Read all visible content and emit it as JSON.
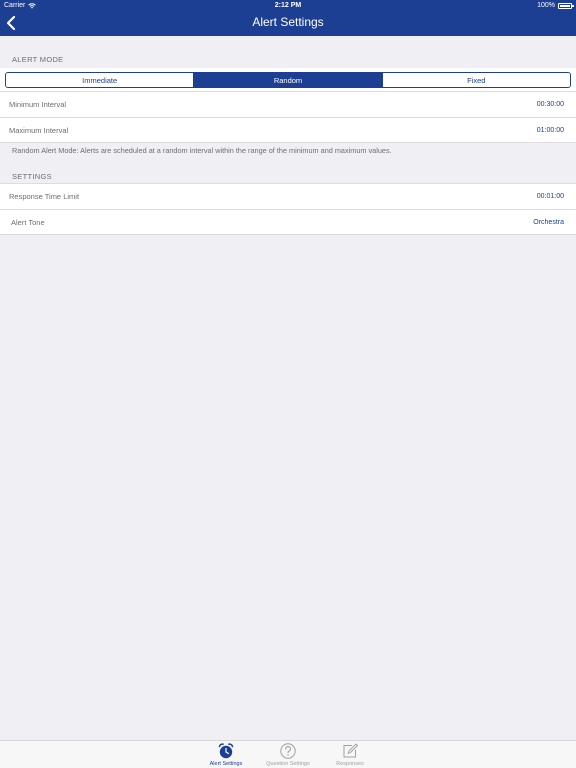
{
  "status_bar": {
    "carrier": "Carrier",
    "time": "2:12 PM",
    "battery": "100%"
  },
  "nav": {
    "title": "Alert Settings",
    "back_icon": "chevron-left-icon"
  },
  "alert_mode": {
    "header": "ALERT MODE",
    "segments": [
      "Immediate",
      "Random",
      "Fixed"
    ],
    "selected": "Random",
    "rows": [
      {
        "label": "Minimum Interval",
        "value": "00:30:00"
      },
      {
        "label": "Maximum Interval",
        "value": "01:00:00"
      }
    ],
    "description": "Random Alert Mode: Alerts are scheduled at a random interval within the range of the minimum and maximum values."
  },
  "settings": {
    "header": "SETTINGS",
    "rows": [
      {
        "label": "Response Time Limit",
        "value": "00:01:00"
      },
      {
        "label": "Alert Tone",
        "value": "Orchestra"
      }
    ]
  },
  "tabs": [
    {
      "label": "Alert Settings",
      "icon": "alarm-clock-icon",
      "active": true
    },
    {
      "label": "Question Settings",
      "icon": "question-circle-icon",
      "active": false
    },
    {
      "label": "Responses",
      "icon": "compose-icon",
      "active": false
    }
  ],
  "colors": {
    "accent": "#1d3f93",
    "background": "#efeff4",
    "secondary_text": "#6d6d72"
  }
}
